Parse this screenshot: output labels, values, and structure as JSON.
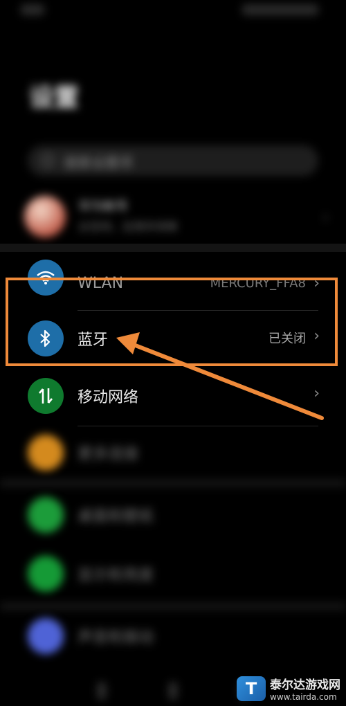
{
  "page": {
    "title": "设置"
  },
  "search": {
    "placeholder": "搜索设置项"
  },
  "account": {
    "name": "华为帐号",
    "sub": "云空间、应用市场等"
  },
  "rows": [
    {
      "label": "WLAN",
      "value": "MERCURY_FFA8",
      "icon": "wifi-icon",
      "color": "#1e6ea8"
    },
    {
      "label": "蓝牙",
      "value": "已关闭",
      "icon": "bluetooth-icon",
      "color": "#1e6ea8"
    },
    {
      "label": "移动网络",
      "value": "",
      "icon": "mobile-data-icon",
      "color": "#0f7a2e"
    },
    {
      "label": "更多连接",
      "value": "",
      "icon": "link-icon",
      "color": "#d48a1e"
    },
    {
      "label": "桌面和壁纸",
      "value": "",
      "icon": "wallpaper-icon",
      "color": "#1c9c3a"
    },
    {
      "label": "显示和亮度",
      "value": "",
      "icon": "display-icon",
      "color": "#159a36"
    },
    {
      "label": "声音和振动",
      "value": "",
      "icon": "sound-icon",
      "color": "#4f63d6"
    }
  ],
  "highlight_color": "#ef8a3a",
  "watermark": {
    "logo": "T",
    "name": "泰尔达游戏网",
    "url": "www.tairda.com"
  }
}
